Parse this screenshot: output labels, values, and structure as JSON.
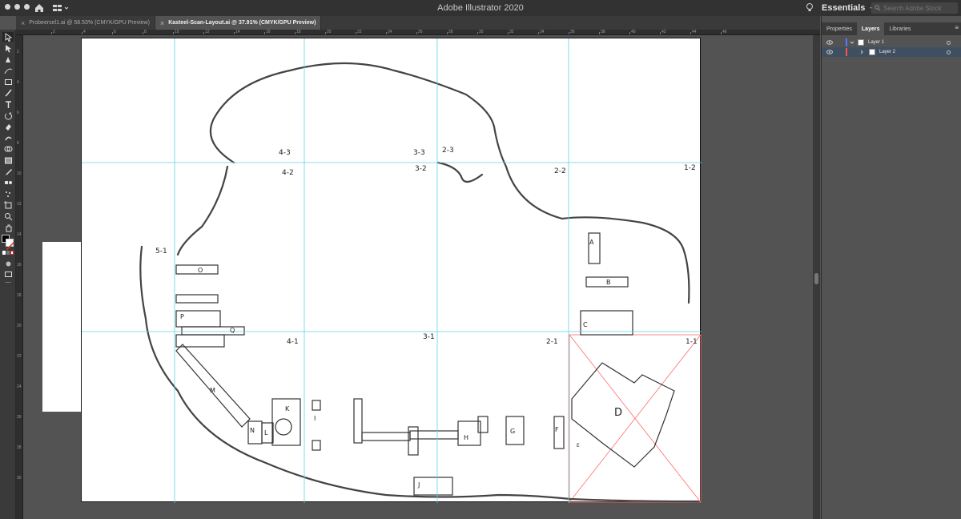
{
  "app": {
    "title": "Adobe Illustrator 2020",
    "workspace": "Essentials",
    "search_placeholder": "Search Adobe Stock"
  },
  "document_tabs": [
    {
      "label": "Probeersel1.ai @ 58.53% (CMYK/GPU Preview)",
      "active": false
    },
    {
      "label": "Kasteel-Scan-Layout.ai @ 37.91% (CMYK/GPU Preview)",
      "active": true
    }
  ],
  "toolbar": {
    "tools": [
      "selection-tool",
      "direct-selection-tool",
      "pen-tool",
      "curvature-tool",
      "rectangle-tool",
      "paintbrush-tool",
      "type-tool",
      "rotate-tool",
      "eraser-tool",
      "warp-tool",
      "shape-builder-tool",
      "gradient-tool",
      "eyedropper-tool",
      "blend-tool",
      "symbol-sprayer-tool",
      "artboard-tool",
      "zoom-tool",
      "hand-tool"
    ],
    "fill_color": "#000000",
    "stroke_color": "#ffffff",
    "more_label": "..."
  },
  "ruler": {
    "top_labels": [
      "2",
      "4",
      "6",
      "8",
      "10",
      "12",
      "14",
      "16",
      "18",
      "20",
      "22",
      "24",
      "26",
      "28",
      "30",
      "32",
      "34",
      "36",
      "38",
      "40",
      "42",
      "44",
      "46"
    ],
    "left_labels": [
      "2",
      "4",
      "6",
      "8",
      "10",
      "12",
      "14",
      "16",
      "18",
      "20",
      "22",
      "24",
      "26",
      "28",
      "30"
    ]
  },
  "panel": {
    "tabs": [
      "Properties",
      "Layers",
      "Libraries"
    ],
    "active_tab": "Layers",
    "menu_icon": "hamburger-icon",
    "layers": [
      {
        "name": "Layer 1",
        "expanded": true,
        "color": "#4f7dff",
        "selected": false
      },
      {
        "name": "Layer 2",
        "expanded": false,
        "color": "#ff4f4f",
        "selected": true
      }
    ]
  },
  "sketch": {
    "grid_labels": [
      "4-3",
      "4-2",
      "3-3",
      "3-2",
      "2-3",
      "2-2",
      "1-2",
      "5-1",
      "4-1",
      "3-1",
      "2-1",
      "1-1"
    ],
    "building_letters": [
      "A",
      "B",
      "C",
      "D",
      "E",
      "F",
      "G",
      "H",
      "I",
      "J",
      "K",
      "L",
      "M",
      "N",
      "O",
      "P",
      "Q"
    ]
  },
  "colors": {
    "guide": "#5fd3e6",
    "artboard_border": "#111111",
    "canvas_bg": "#535353",
    "chrome": "#323232",
    "selection_highlight": "#3f4f61",
    "trim_marks": "#ff6b6b"
  }
}
